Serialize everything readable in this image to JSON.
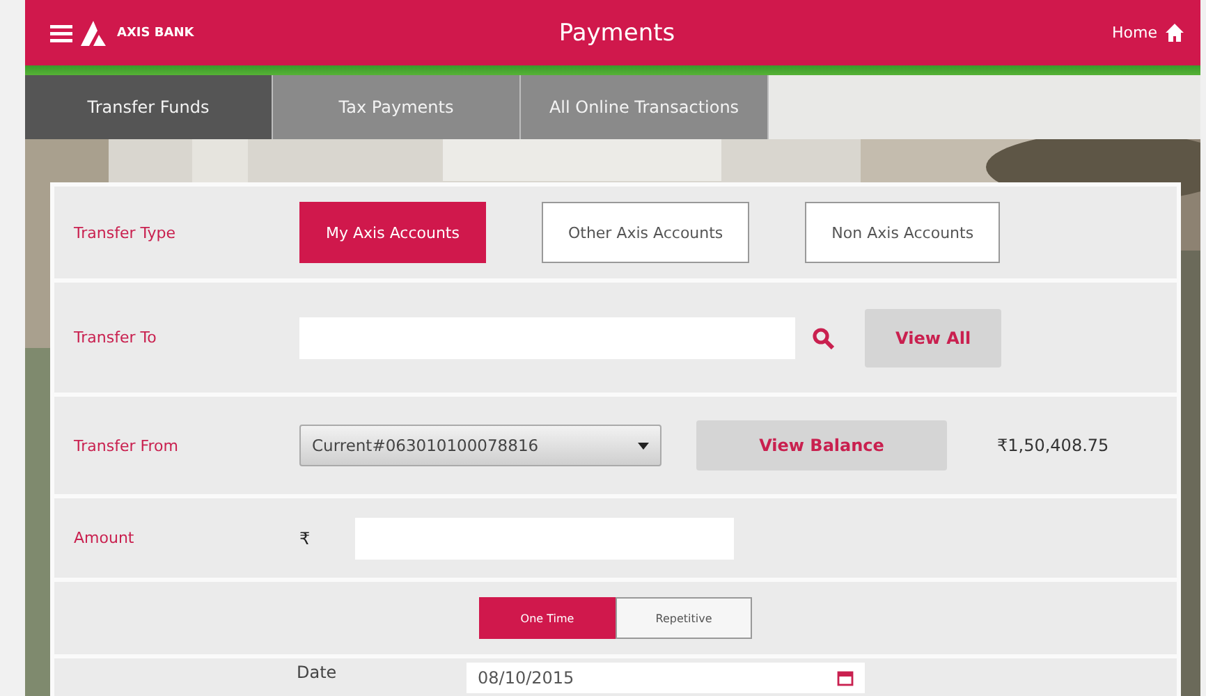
{
  "header": {
    "brand": "AXIS BANK",
    "title": "Payments",
    "home": "Home"
  },
  "tabs": [
    {
      "label": "Transfer Funds",
      "selected": true
    },
    {
      "label": "Tax Payments",
      "selected": false
    },
    {
      "label": "All Online Transactions",
      "selected": false
    }
  ],
  "form": {
    "transfer_type": {
      "label": "Transfer Type",
      "options": [
        {
          "label": "My Axis Accounts",
          "selected": true
        },
        {
          "label": "Other Axis Accounts",
          "selected": false
        },
        {
          "label": "Non Axis Accounts",
          "selected": false
        }
      ]
    },
    "transfer_to": {
      "label": "Transfer To",
      "button": "View All"
    },
    "transfer_from": {
      "label": "Transfer From",
      "account": "Current#063010100078816",
      "button": "View Balance",
      "balance": "₹1,50,408.75"
    },
    "amount": {
      "label": "Amount",
      "currency": "₹"
    },
    "frequency": [
      {
        "label": "One Time",
        "selected": true
      },
      {
        "label": "Repetitive",
        "selected": false
      }
    ],
    "date": {
      "label": "Date",
      "value": "08/10/2015"
    }
  }
}
